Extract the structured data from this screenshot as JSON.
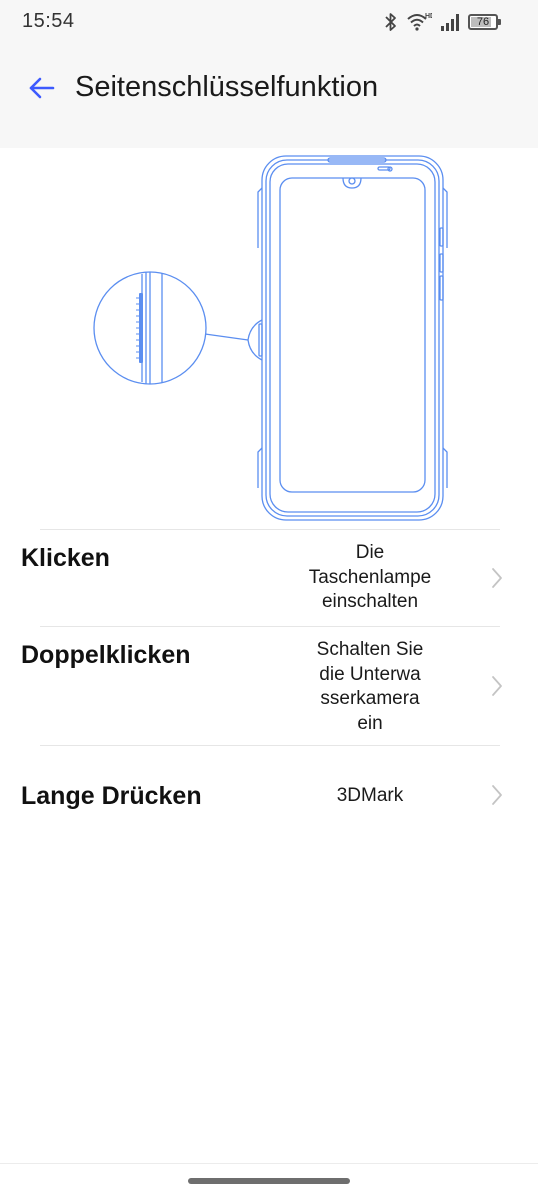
{
  "status_bar": {
    "time": "15:54",
    "battery_level": "76",
    "network_badge": "HD",
    "icons": [
      "bluetooth-icon",
      "wifi-icon",
      "cell-signal-icon",
      "battery-icon"
    ]
  },
  "header": {
    "title": "Seitenschlüsselfunktion",
    "back_icon": "arrow-left-icon"
  },
  "colors": {
    "accent": "#3d5afe",
    "illustration_stroke": "#5b8ef0",
    "header_bg": "#f7f7f7"
  },
  "illustration": {
    "description_icon": "phone-side-key-icon"
  },
  "settings": [
    {
      "label": "Klicken",
      "value_lines": [
        "Die",
        "Taschenlampe",
        "einschalten"
      ]
    },
    {
      "label": "Doppelklicken",
      "value_lines": [
        "Schalten Sie",
        "die Unterwa",
        "sserkamera",
        "ein"
      ]
    },
    {
      "label": "Lange Drücken",
      "value_lines": [
        "3DMark"
      ]
    }
  ]
}
